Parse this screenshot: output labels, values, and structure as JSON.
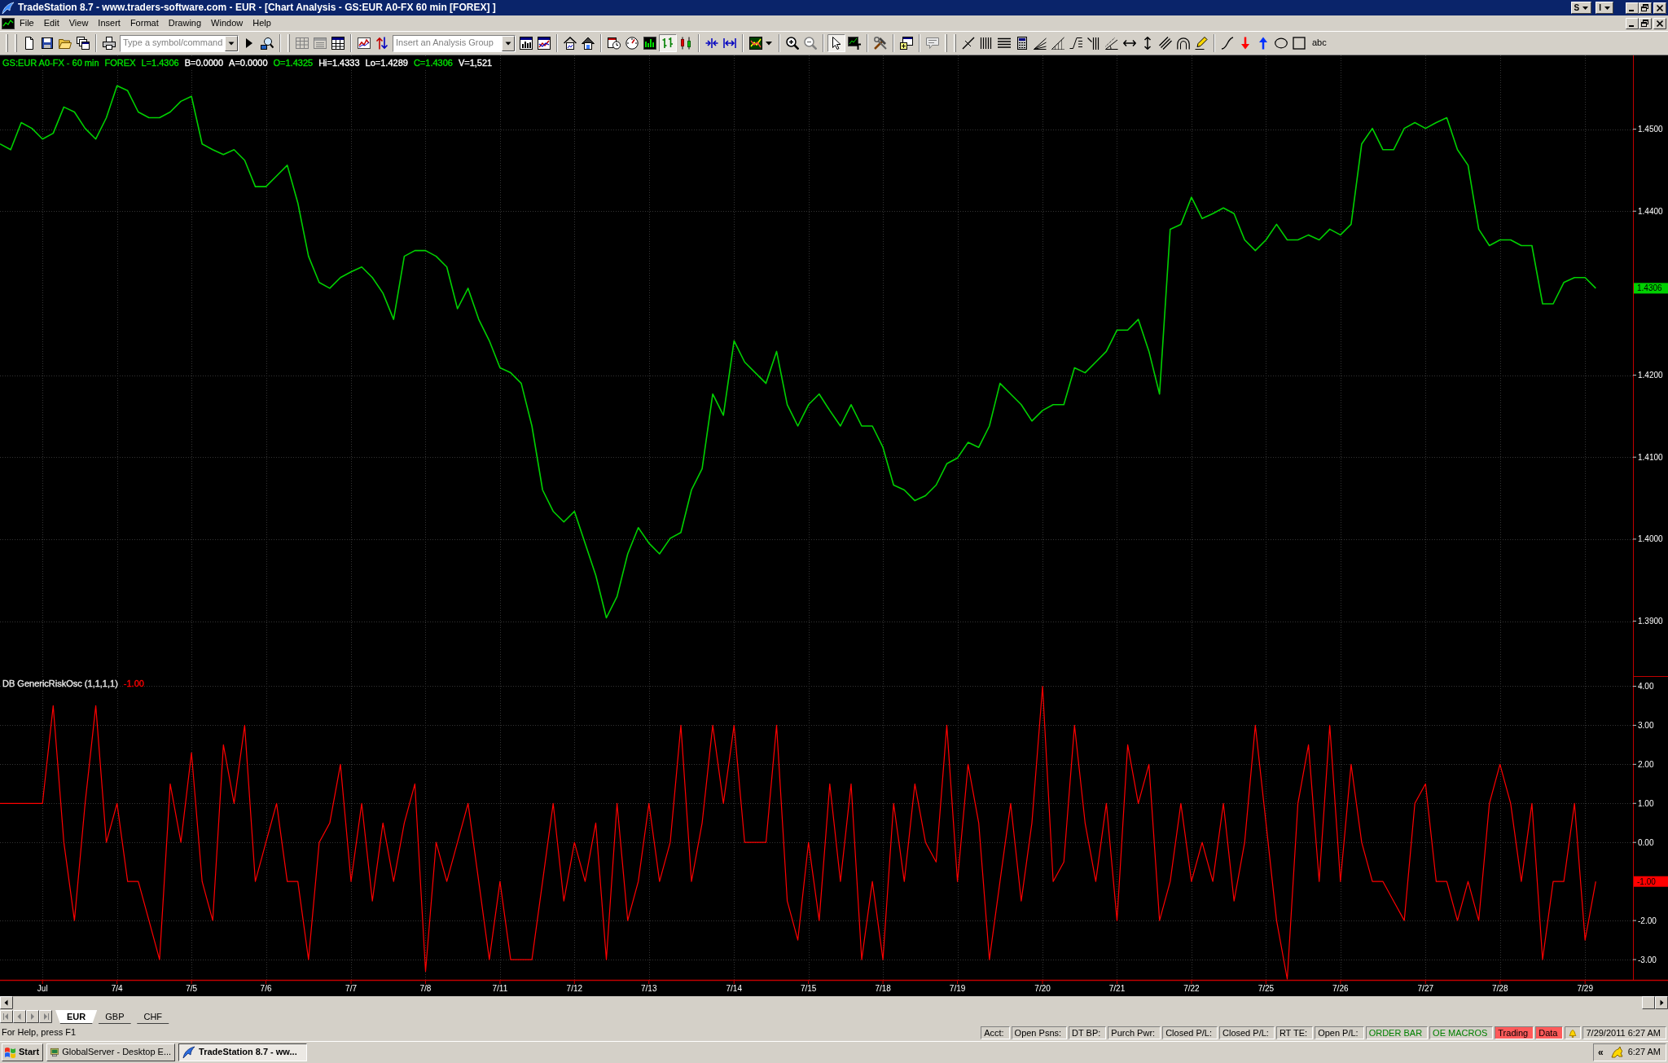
{
  "window": {
    "title": "TradeStation 8.7 - www.traders-software.com - EUR - [Chart Analysis - GS:EUR A0-FX 60 min [FOREX] ]",
    "title_buttons": [
      "S",
      "I"
    ]
  },
  "menu": [
    "File",
    "Edit",
    "View",
    "Insert",
    "Format",
    "Drawing",
    "Window",
    "Help"
  ],
  "toolbar": {
    "symbol_field": {
      "placeholder": "Type a symbol/command"
    },
    "analysis_group_field": {
      "placeholder": "Insert an Analysis Group"
    },
    "bar_chart_button_pressed": true,
    "pointer_button_pressed": true,
    "text_tool": "abc"
  },
  "price_pane": {
    "header": [
      {
        "text": "GS:EUR A0-FX - 60 min",
        "color": "#00e000"
      },
      {
        "text": "FOREX",
        "color": "#00e000"
      },
      {
        "text": "L=1.4306",
        "color": "#00e000"
      },
      {
        "text": "B=0.0000",
        "color": "#ffffff"
      },
      {
        "text": "A=0.0000",
        "color": "#ffffff"
      },
      {
        "text": "O=1.4325",
        "color": "#00e000"
      },
      {
        "text": "Hi=1.4333",
        "color": "#ffffff"
      },
      {
        "text": "Lo=1.4289",
        "color": "#ffffff"
      },
      {
        "text": "C=1.4306",
        "color": "#00e000"
      },
      {
        "text": "V=1,521",
        "color": "#ffffff"
      }
    ],
    "last_value_label": "1.4306",
    "chart_data": {
      "type": "line",
      "grid": true,
      "series": [
        {
          "color": "#00d000",
          "values": [
            1.4482,
            1.4475,
            1.4508,
            1.4501,
            1.4488,
            1.4495,
            1.4527,
            1.4521,
            1.4501,
            1.4488,
            1.4514,
            1.4553,
            1.4547,
            1.4521,
            1.4514,
            1.4514,
            1.4521,
            1.4534,
            1.454,
            1.4482,
            1.4475,
            1.4469,
            1.4475,
            1.4462,
            1.443,
            1.443,
            1.4443,
            1.4456,
            1.441,
            1.4345,
            1.4313,
            1.4306,
            1.4319,
            1.4326,
            1.4332,
            1.4319,
            1.43,
            1.4268,
            1.4345,
            1.4352,
            1.4352,
            1.4345,
            1.4332,
            1.4281,
            1.4306,
            1.4268,
            1.4242,
            1.4209,
            1.4203,
            1.419,
            1.4138,
            1.406,
            1.4034,
            1.4021,
            1.4034,
            1.3995,
            1.3956,
            1.3904,
            1.393,
            1.3982,
            1.4014,
            1.3995,
            1.3982,
            1.4001,
            1.4008,
            1.406,
            1.4086,
            1.4177,
            1.4151,
            1.4242,
            1.4216,
            1.4203,
            1.419,
            1.4229,
            1.4164,
            1.4138,
            1.4164,
            1.4177,
            1.4157,
            1.4138,
            1.4164,
            1.4138,
            1.4138,
            1.4112,
            1.4066,
            1.406,
            1.4047,
            1.4053,
            1.4066,
            1.4092,
            1.4099,
            1.4118,
            1.4112,
            1.4138,
            1.419,
            1.4177,
            1.4164,
            1.4144,
            1.4157,
            1.4164,
            1.4164,
            1.4209,
            1.4203,
            1.4216,
            1.4229,
            1.4255,
            1.4255,
            1.4268,
            1.4229,
            1.4177,
            1.4378,
            1.4384,
            1.4417,
            1.4391,
            1.4397,
            1.4404,
            1.4397,
            1.4365,
            1.4352,
            1.4365,
            1.4384,
            1.4365,
            1.4365,
            1.4371,
            1.4365,
            1.4378,
            1.4371,
            1.4384,
            1.4482,
            1.4501,
            1.4475,
            1.4475,
            1.4501,
            1.4508,
            1.4501,
            1.4508,
            1.4514,
            1.4475,
            1.4456,
            1.4378,
            1.4358,
            1.4365,
            1.4365,
            1.4358,
            1.4358,
            1.4287,
            1.4287,
            1.4313,
            1.4319,
            1.4319,
            1.4306
          ]
        }
      ],
      "ylim": [
        1.3833,
        1.459
      ],
      "yticks": [
        {
          "value": 1.45,
          "label": "1.4500"
        },
        {
          "value": 1.44,
          "label": "1.4400"
        },
        {
          "value": 1.42,
          "label": "1.4200"
        },
        {
          "value": 1.41,
          "label": "1.4100"
        },
        {
          "value": 1.4,
          "label": "1.4000"
        },
        {
          "value": 1.39,
          "label": "1.3900"
        }
      ]
    }
  },
  "indicator_pane": {
    "header": [
      {
        "text": "DB GenericRiskOsc (1,1,1,1)",
        "color": "#e8e8e8"
      },
      {
        "text": "-1.00",
        "color": "#ff0000"
      }
    ],
    "last_value_label": "-1.00",
    "chart_data": {
      "type": "line",
      "grid": true,
      "categories": [
        null,
        null,
        null,
        null,
        "Jul",
        null,
        null,
        null,
        null,
        null,
        null,
        "7/4",
        null,
        null,
        null,
        null,
        null,
        null,
        "7/5",
        null,
        null,
        null,
        null,
        null,
        null,
        "7/6",
        null,
        null,
        null,
        null,
        null,
        null,
        null,
        "7/7",
        null,
        null,
        null,
        null,
        null,
        null,
        "7/8",
        null,
        null,
        null,
        null,
        null,
        null,
        "7/11",
        null,
        null,
        null,
        null,
        null,
        null,
        "7/12",
        null,
        null,
        null,
        null,
        null,
        null,
        "7/13",
        null,
        null,
        null,
        null,
        null,
        null,
        null,
        "7/14",
        null,
        null,
        null,
        null,
        null,
        null,
        "7/15",
        null,
        null,
        null,
        null,
        null,
        null,
        "7/18",
        null,
        null,
        null,
        null,
        null,
        null,
        "7/19",
        null,
        null,
        null,
        null,
        null,
        null,
        null,
        "7/20",
        null,
        null,
        null,
        null,
        null,
        null,
        "7/21",
        null,
        null,
        null,
        null,
        null,
        null,
        "7/22",
        null,
        null,
        null,
        null,
        null,
        null,
        "7/25",
        null,
        null,
        null,
        null,
        null,
        null,
        "7/26",
        null,
        null,
        null,
        null,
        null,
        null,
        null,
        "7/27",
        null,
        null,
        null,
        null,
        null,
        null,
        "7/28",
        null,
        null,
        null,
        null,
        null,
        null,
        null,
        "7/29",
        null
      ],
      "series": [
        {
          "color": "#ff0000",
          "values": [
            1,
            1,
            1,
            1,
            1,
            3.5,
            0,
            -2,
            1,
            3.5,
            0,
            1,
            -1,
            -1,
            -2,
            -3,
            1.5,
            0,
            2.3,
            -1,
            -2,
            2.5,
            1,
            3,
            -1,
            0,
            1,
            -1,
            -1,
            -3,
            0,
            0.5,
            2,
            -1,
            1,
            -1.5,
            0.5,
            -1,
            0.5,
            1.5,
            -3.3,
            0,
            -1,
            0,
            1,
            -1,
            -3,
            -1,
            -3,
            -3,
            -3,
            -1,
            1,
            -1.5,
            0,
            -1,
            0.5,
            -3,
            1,
            -2,
            -1,
            1,
            -1,
            0,
            3,
            -1,
            0.5,
            3,
            1,
            3,
            0,
            0,
            0,
            3,
            -1.5,
            -2.5,
            0,
            -2,
            1.5,
            -1,
            1.5,
            -3,
            -1,
            -3,
            1,
            -1,
            1.5,
            0,
            -0.5,
            3,
            -1,
            2,
            0.5,
            -3,
            -1,
            1,
            -1.5,
            0.5,
            4,
            -1,
            -0.5,
            3,
            0.5,
            -1,
            1,
            -2,
            2.5,
            1,
            2,
            -2,
            -1,
            1,
            -1,
            0,
            -1,
            1,
            -1.5,
            0,
            3,
            0.5,
            -2,
            -3.5,
            1,
            2.5,
            -1,
            3,
            -1,
            2,
            0,
            -1,
            -1,
            -1.5,
            -2,
            1,
            1.5,
            -1,
            -1,
            -2,
            -1,
            -2,
            1,
            2,
            1,
            -1,
            1,
            -3,
            -1,
            -1,
            1,
            -2.5,
            -1
          ]
        }
      ],
      "ylim": [
        -3.52,
        4.26
      ],
      "yticks": [
        {
          "value": 4,
          "label": "4.00"
        },
        {
          "value": 3,
          "label": "3.00"
        },
        {
          "value": 2,
          "label": "2.00"
        },
        {
          "value": 1,
          "label": "1.00"
        },
        {
          "value": 0,
          "label": "0.00"
        },
        {
          "value": -2,
          "label": "-2.00"
        },
        {
          "value": -3,
          "label": "-3.00"
        }
      ]
    }
  },
  "sheet_tabs": [
    {
      "label": "EUR",
      "selected": true
    },
    {
      "label": "GBP",
      "selected": false
    },
    {
      "label": "CHF",
      "selected": false
    }
  ],
  "status_bar": {
    "help_text": "For Help, press F1",
    "panes": [
      {
        "text": "Acct:",
        "kind": "plain"
      },
      {
        "text": "Open Psns:",
        "kind": "plain"
      },
      {
        "text": "DT BP:",
        "kind": "plain"
      },
      {
        "text": "Purch Pwr:",
        "kind": "plain"
      },
      {
        "text": "Closed P/L:",
        "kind": "plain"
      },
      {
        "text": "Closed P/L:",
        "kind": "plain"
      },
      {
        "text": "RT TE:",
        "kind": "plain"
      },
      {
        "text": "Open P/L:",
        "kind": "plain"
      },
      {
        "text": "ORDER BAR",
        "kind": "ok"
      },
      {
        "text": "OE MACROS",
        "kind": "ok"
      },
      {
        "text": "Trading",
        "kind": "alert"
      },
      {
        "text": "Data",
        "kind": "alert"
      }
    ],
    "clock": "7/29/2011 6:27 AM"
  },
  "taskbar": {
    "start": "Start",
    "tasks": [
      {
        "label": "GlobalServer - Desktop E...",
        "selected": false
      },
      {
        "label": "TradeStation 8.7 - ww...",
        "selected": true
      }
    ],
    "tray_expand": "«",
    "clock": "6:27 AM"
  }
}
